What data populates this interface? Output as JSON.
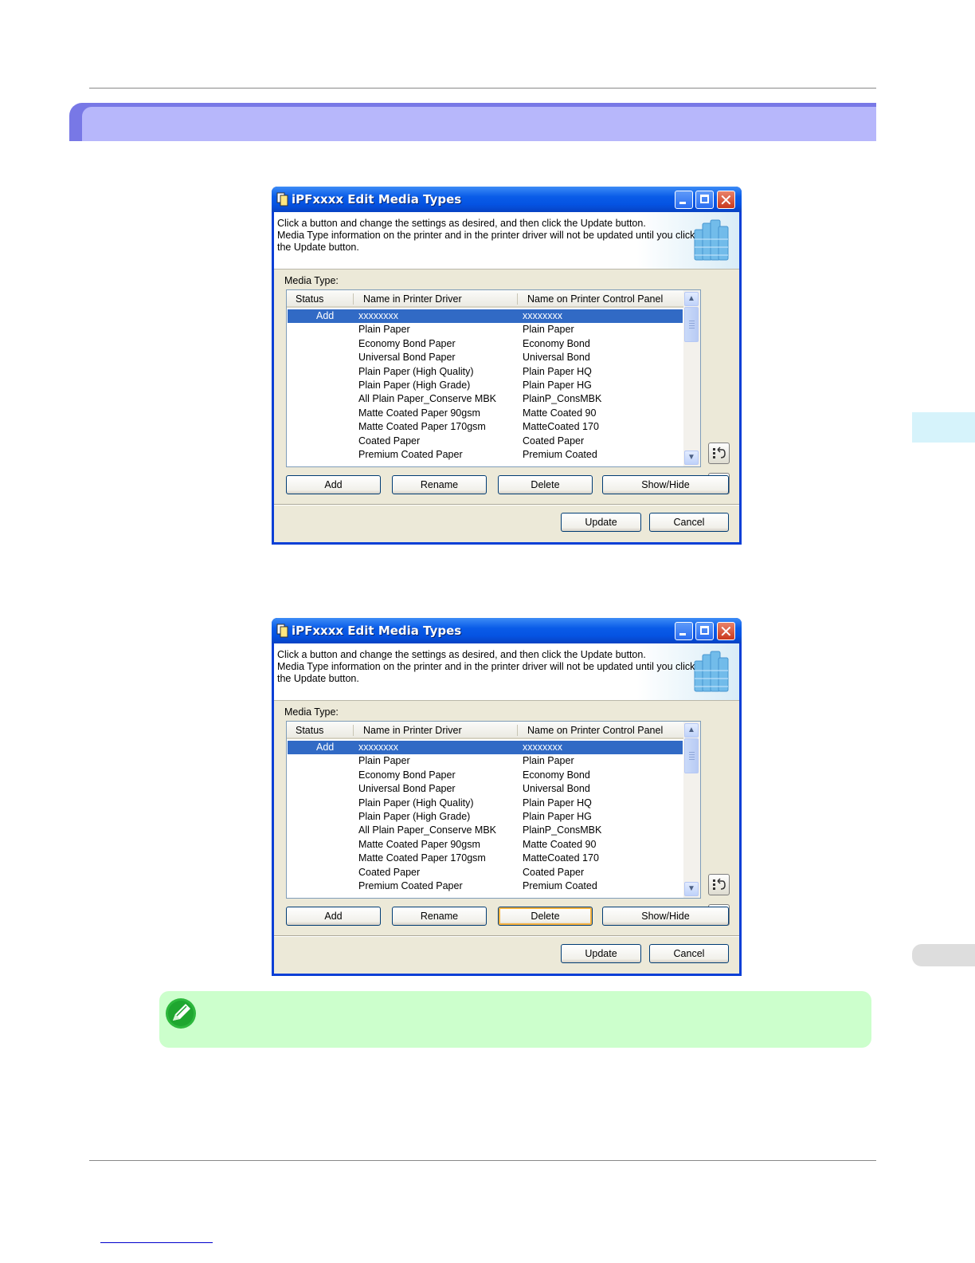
{
  "dialogs": [
    {
      "title": "iPFxxxx Edit Media Types",
      "instructions": [
        "Click a button and change the settings as desired, and then click the Update button.",
        "Media Type information on the printer and in the printer driver will not be updated until you click",
        "the Update button."
      ],
      "media_type_label": "Media Type:",
      "columns": [
        "Status",
        "Name in Printer Driver",
        "Name on Printer Control Panel"
      ],
      "rows": [
        {
          "status": "Add",
          "driver": "xxxxxxxx",
          "panel": "xxxxxxxx"
        },
        {
          "status": "",
          "driver": "Plain Paper",
          "panel": "Plain Paper"
        },
        {
          "status": "",
          "driver": "Economy Bond Paper",
          "panel": "Economy Bond"
        },
        {
          "status": "",
          "driver": "Universal Bond Paper",
          "panel": "Universal Bond"
        },
        {
          "status": "",
          "driver": "Plain Paper (High Quality)",
          "panel": "Plain Paper HQ"
        },
        {
          "status": "",
          "driver": "Plain Paper (High Grade)",
          "panel": "Plain Paper HG"
        },
        {
          "status": "",
          "driver": "All Plain Paper_Conserve MBK",
          "panel": "PlainP_ConsMBK"
        },
        {
          "status": "",
          "driver": "Matte Coated Paper 90gsm",
          "panel": "Matte Coated 90"
        },
        {
          "status": "",
          "driver": "Matte Coated Paper 170gsm",
          "panel": "MatteCoated 170"
        },
        {
          "status": "",
          "driver": "Coated Paper",
          "panel": "Coated Paper"
        },
        {
          "status": "",
          "driver": "Premium Coated Paper",
          "panel": "Premium Coated"
        }
      ],
      "buttons": {
        "add": "Add",
        "rename": "Rename",
        "delete": "Delete",
        "show_hide": "Show/Hide",
        "update": "Update",
        "cancel": "Cancel"
      },
      "focused_button": "none"
    },
    {
      "title": "iPFxxxx Edit Media Types",
      "instructions": [
        "Click a button and change the settings as desired, and then click the Update button.",
        "Media Type information on the printer and in the printer driver will not be updated until you click",
        "the Update button."
      ],
      "media_type_label": "Media Type:",
      "columns": [
        "Status",
        "Name in Printer Driver",
        "Name on Printer Control Panel"
      ],
      "rows": [
        {
          "status": "Add",
          "driver": "xxxxxxxx",
          "panel": "xxxxxxxx"
        },
        {
          "status": "",
          "driver": "Plain Paper",
          "panel": "Plain Paper"
        },
        {
          "status": "",
          "driver": "Economy Bond Paper",
          "panel": "Economy Bond"
        },
        {
          "status": "",
          "driver": "Universal Bond Paper",
          "panel": "Universal Bond"
        },
        {
          "status": "",
          "driver": "Plain Paper (High Quality)",
          "panel": "Plain Paper HQ"
        },
        {
          "status": "",
          "driver": "Plain Paper (High Grade)",
          "panel": "Plain Paper HG"
        },
        {
          "status": "",
          "driver": "All Plain Paper_Conserve MBK",
          "panel": "PlainP_ConsMBK"
        },
        {
          "status": "",
          "driver": "Matte Coated Paper 90gsm",
          "panel": "Matte Coated 90"
        },
        {
          "status": "",
          "driver": "Matte Coated Paper 170gsm",
          "panel": "MatteCoated 170"
        },
        {
          "status": "",
          "driver": "Coated Paper",
          "panel": "Coated Paper"
        },
        {
          "status": "",
          "driver": "Premium Coated Paper",
          "panel": "Premium Coated"
        }
      ],
      "buttons": {
        "add": "Add",
        "rename": "Rename",
        "delete": "Delete",
        "show_hide": "Show/Hide",
        "update": "Update",
        "cancel": "Cancel"
      },
      "focused_button": "delete"
    }
  ],
  "colors": {
    "section_bar": "#b7b7fb",
    "note_background": "#ccffcc",
    "selection": "#316ac5",
    "titlebar": "#0553e2"
  },
  "icons": [
    "note-pencil-icon",
    "sort-up-icon",
    "sort-down-icon",
    "media-types-app-icon"
  ]
}
